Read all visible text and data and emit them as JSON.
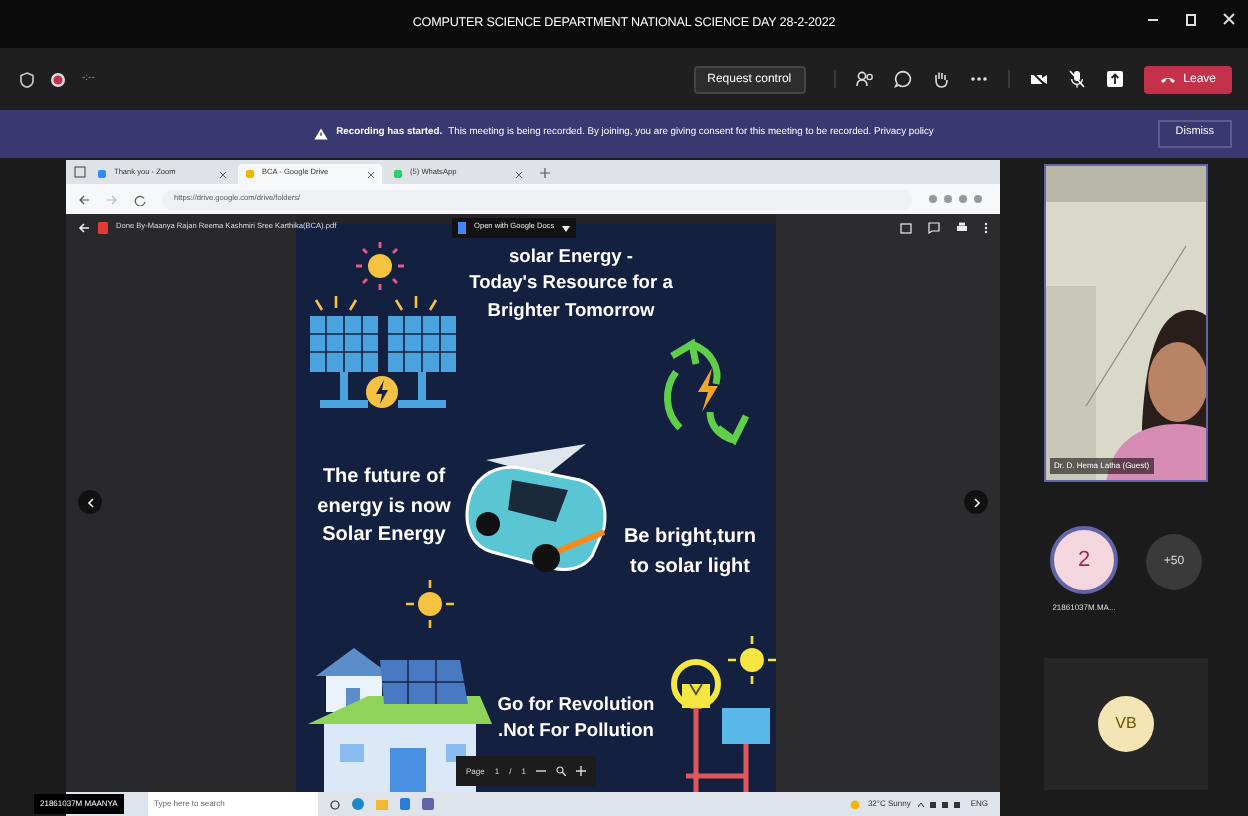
{
  "window": {
    "title": "COMPUTER SCIENCE DEPARTMENT NATIONAL SCIENCE DAY 28-2-2022"
  },
  "toolbar": {
    "timer": "-:--",
    "recording": true,
    "request_button": "Request control",
    "leave_button": "Leave"
  },
  "banner": {
    "title": "Recording has started.",
    "message": "This meeting is being recorded. By joining, you are giving consent for this meeting to be recorded.",
    "link": "Privacy policy",
    "dismiss": "Dismiss"
  },
  "shared_screen": {
    "presenter": "21861037M MAANYA",
    "browser": {
      "tabs": [
        {
          "label": "Thank you - Zoom",
          "selected": false
        },
        {
          "label": "BCA - Google Drive",
          "selected": true
        },
        {
          "label": "(5) WhatsApp",
          "selected": false
        }
      ],
      "url": "https://drive.google.com/drive/folders/"
    },
    "viewer": {
      "file_name": "Done By-Maanya Rajan Reema Kashmiri Sree Karthika(BCA).pdf",
      "open_button": "Open with Google Docs",
      "page_label": "Page",
      "page": "1",
      "separator": "/",
      "pages": "1"
    },
    "poster": {
      "headline": "solar Energy -\nToday's Resource for a\nBrighter Tomorrow",
      "left_text": "The future of\nenergy is now\nSolar Energy",
      "right_text": "Be bright,turn\nto solar light",
      "bottom_text": "Go for Revolution\n.Not For Pollution"
    },
    "taskbar": {
      "search_placeholder": "Type here to search",
      "weather": "32°C Sunny",
      "language": "ENG"
    }
  },
  "participants": {
    "video": {
      "name": "Dr. D. Hema Latha (Guest)",
      "kind": "picture"
    },
    "avatars": [
      {
        "initials": "2",
        "name": "21861037M.MA..."
      },
      {
        "initials": "+50"
      }
    ],
    "tile": {
      "initials": "VB"
    }
  }
}
